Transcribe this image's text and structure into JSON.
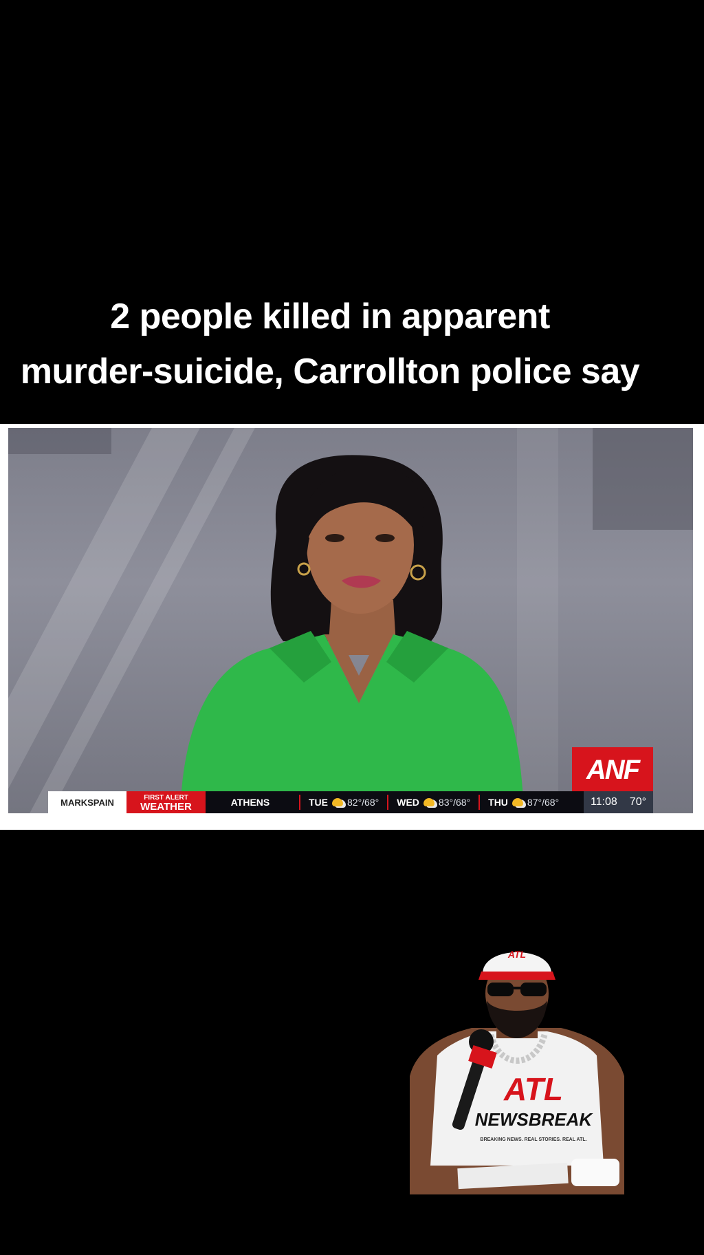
{
  "headline": {
    "line1": "2 people killed in apparent",
    "line2": "murder-suicide, Carrollton police say"
  },
  "broadcast": {
    "station_logo": "ANF",
    "sponsor": "MARKSPAIN",
    "alert_small": "FIRST ALERT",
    "alert_big": "WEATHER",
    "city": "ATHENS",
    "forecast": [
      {
        "day": "TUE",
        "temps": "82°/68°"
      },
      {
        "day": "WED",
        "temps": "83°/68°"
      },
      {
        "day": "THU",
        "temps": "87°/68°"
      }
    ],
    "time": "11:08",
    "current_temp": "70°"
  },
  "overlay": {
    "brand_top": "ATL",
    "brand_bottom": "NEWSBREAK",
    "tagline": "BREAKING NEWS. REAL STORIES. REAL ATL."
  },
  "colors": {
    "background": "#000000",
    "accent_red": "#d7141c",
    "shirt_green": "#2fb84a"
  }
}
